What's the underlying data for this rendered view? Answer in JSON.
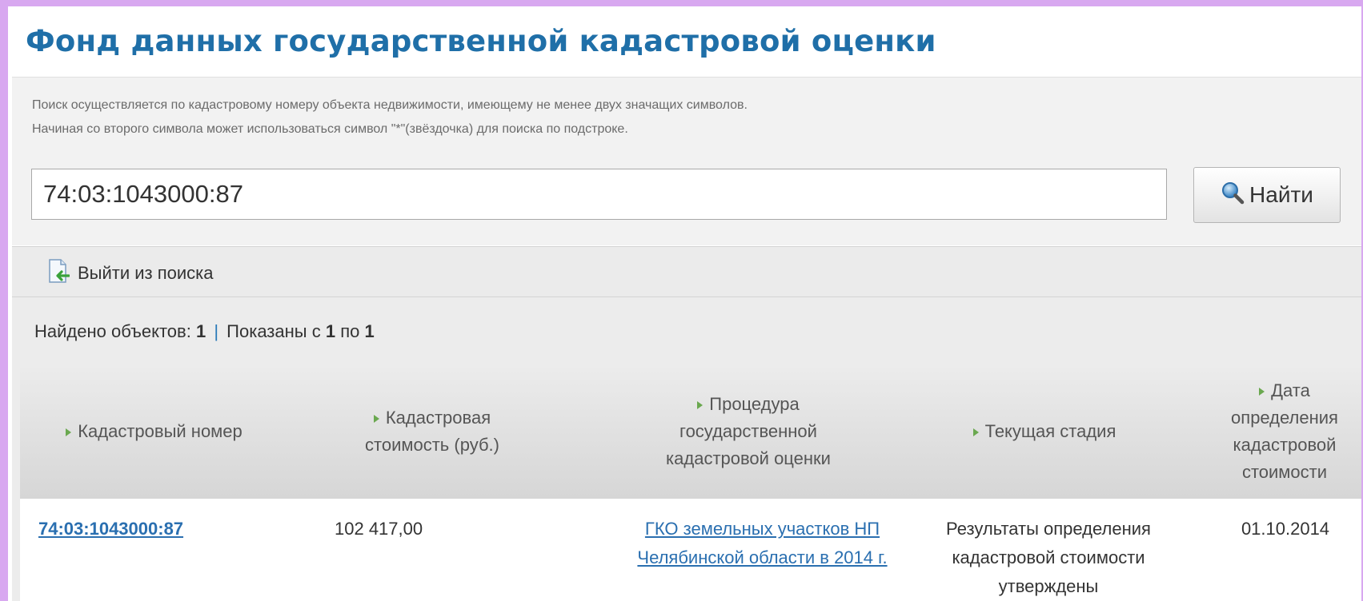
{
  "page": {
    "title": "Фонд данных государственной кадастровой оценки"
  },
  "search": {
    "hint_line1": "Поиск осуществляется по кадастровому номеру объекта недвижимости, имеющему не менее двух значащих символов.",
    "hint_line2": "Начиная со второго символа может использоваться символ \"*\"(звёздочка) для поиска по подстроке.",
    "value": "74:03:1043000:87",
    "button_label": "Найти",
    "button_icon": "magnifier-icon"
  },
  "exit": {
    "label": "Выйти из поиска",
    "icon": "exit-document-icon"
  },
  "results_summary": {
    "found_label": "Найдено объектов:",
    "found_count": "1",
    "separator": "|",
    "shown_label": "Показаны с",
    "shown_from": "1",
    "shown_to_label": "по",
    "shown_to": "1"
  },
  "table": {
    "columns": [
      {
        "label": "Кадастровый номер"
      },
      {
        "label": "Кадастровая стоимость (руб.)"
      },
      {
        "label": "Процедура государственной кадастровой оценки"
      },
      {
        "label": "Текущая стадия"
      },
      {
        "label": "Дата определения кадастровой стоимости"
      }
    ],
    "rows": [
      {
        "cadastral_number": "74:03:1043000:87",
        "value": "102 417,00",
        "procedure": "ГКО земельных участков НП Челябинской области в 2014 г.",
        "stage": "Результаты определения кадастровой стоимости утверждены",
        "date": "01.10.2014"
      }
    ]
  },
  "colors": {
    "title": "#1f6fa8",
    "link": "#2a6fb0",
    "sort_arrow": "#6aa84f",
    "frame_border": "#d8a8f0"
  }
}
